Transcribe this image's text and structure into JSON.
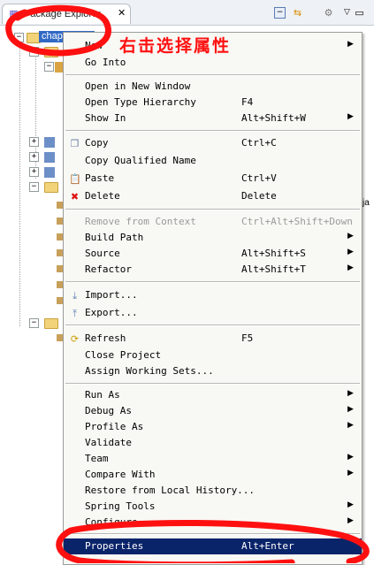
{
  "view": {
    "tab_title": "Package Explorer",
    "close_glyph": "✕",
    "tree_selected_label": "chapter0",
    "right_edge_text": "ja"
  },
  "annotation": {
    "text": "右击选择属性",
    "color": "#ff1010"
  },
  "menu": {
    "items": [
      {
        "label": "New",
        "accel": "",
        "submenu": true
      },
      {
        "label": "Go Into",
        "accel": ""
      },
      {
        "label": "Open in New Window",
        "accel": ""
      },
      {
        "label": "Open Type Hierarchy",
        "accel": "F4"
      },
      {
        "label": "Show In",
        "accel": "Alt+Shift+W",
        "submenu": true
      },
      {
        "label": "Copy",
        "accel": "Ctrl+C",
        "icon": "copy-icon"
      },
      {
        "label": "Copy Qualified Name",
        "accel": ""
      },
      {
        "label": "Paste",
        "accel": "Ctrl+V",
        "icon": "paste-icon"
      },
      {
        "label": "Delete",
        "accel": "Delete",
        "icon": "delete-icon"
      },
      {
        "label": "Remove from Context",
        "accel": "Ctrl+Alt+Shift+Down",
        "disabled": true
      },
      {
        "label": "Build Path",
        "accel": "",
        "submenu": true
      },
      {
        "label": "Source",
        "accel": "Alt+Shift+S",
        "submenu": true
      },
      {
        "label": "Refactor",
        "accel": "Alt+Shift+T",
        "submenu": true
      },
      {
        "label": "Import...",
        "accel": "",
        "icon": "import-icon"
      },
      {
        "label": "Export...",
        "accel": "",
        "icon": "export-icon"
      },
      {
        "label": "Refresh",
        "accel": "F5",
        "icon": "refresh-icon"
      },
      {
        "label": "Close Project",
        "accel": ""
      },
      {
        "label": "Assign Working Sets...",
        "accel": ""
      },
      {
        "label": "Run As",
        "accel": "",
        "submenu": true
      },
      {
        "label": "Debug As",
        "accel": "",
        "submenu": true
      },
      {
        "label": "Profile As",
        "accel": "",
        "submenu": true
      },
      {
        "label": "Validate",
        "accel": ""
      },
      {
        "label": "Team",
        "accel": "",
        "submenu": true
      },
      {
        "label": "Compare With",
        "accel": "",
        "submenu": true
      },
      {
        "label": "Restore from Local History...",
        "accel": ""
      },
      {
        "label": "Spring Tools",
        "accel": "",
        "submenu": true
      },
      {
        "label": "Configure",
        "accel": "",
        "submenu": true
      },
      {
        "label": "Properties",
        "accel": "Alt+Enter",
        "highlighted": true
      }
    ],
    "submenu_glyph": "▶"
  },
  "colors": {
    "selection": "#316ac5",
    "menu_highlight": "#0a246a",
    "annotation_red": "#ff1010"
  }
}
